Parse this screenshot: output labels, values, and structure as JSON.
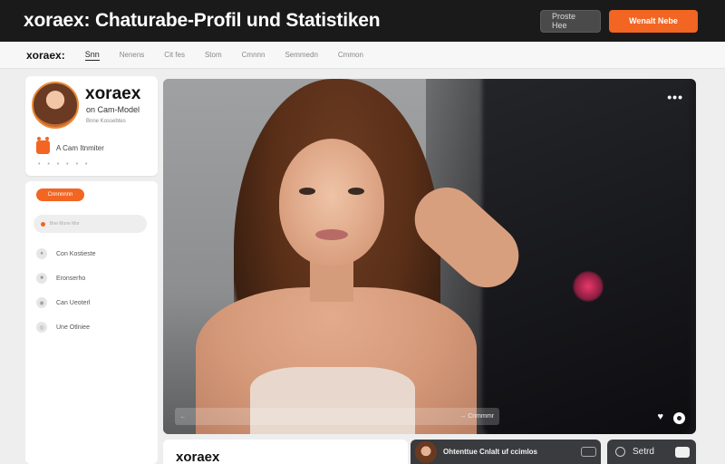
{
  "header": {
    "title": "xoraex: Chaturabe-Profil und Statistiken",
    "secondary_button": "Proste Hee",
    "primary_button": "Wenalt Nebe"
  },
  "subnav": {
    "brand": "xoraex:",
    "tabs": [
      "Snn",
      "Nenens",
      "Cit fes",
      "Stom",
      "Cmnnn",
      "Semmedn",
      "Cmmon"
    ]
  },
  "profile": {
    "name": "xoraex",
    "role": "on Cam-Model",
    "meta": "Bnne Kossebtes",
    "cam_label": "A Cam Itnmiter",
    "dots": "• • • • • •"
  },
  "sidebar": {
    "pill": "Cnnnnnnn",
    "search_placeholder": "Bne Mone Mor",
    "items": [
      {
        "label": "Con Kostieste",
        "icon": "user-icon"
      },
      {
        "label": "Eronserho",
        "icon": "grid-icon"
      },
      {
        "label": "Can Ueoterl",
        "icon": "camera-icon"
      },
      {
        "label": "Une Otlniee",
        "icon": "globe-icon"
      }
    ]
  },
  "video": {
    "more": "•••",
    "bar_left": "←",
    "bar_right": "→ Cnmmmr",
    "heart": "♥"
  },
  "bottom": {
    "name": "xoraex",
    "panel_text": "Ohtenttue Cnlalt uf ccimlos",
    "panel2_text": "Setrd"
  },
  "colors": {
    "accent": "#f26522",
    "header_bg": "#1a1a1a"
  }
}
